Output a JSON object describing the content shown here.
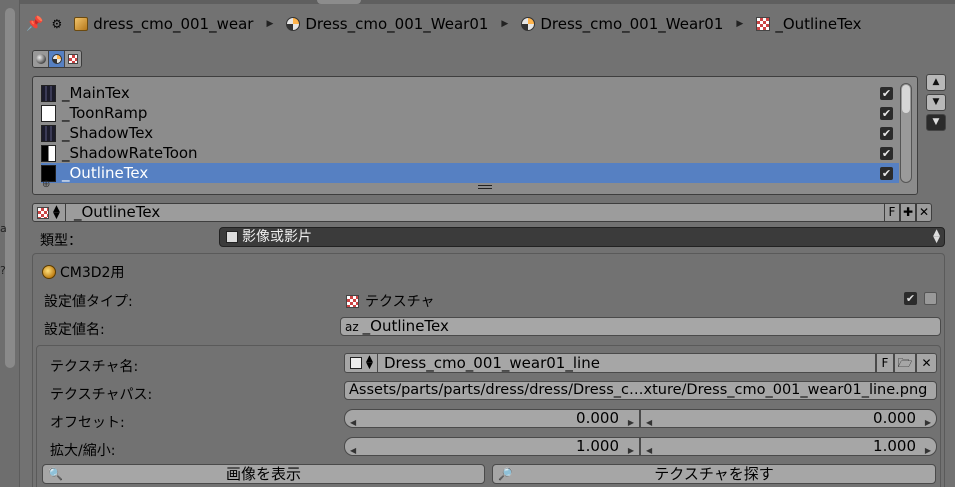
{
  "breadcrumb": {
    "items": [
      {
        "label": "dress_cmo_001_wear",
        "icon": "object-cube-icon"
      },
      {
        "label": "Dress_cmo_001_Wear01",
        "icon": "material-sphere-icon"
      },
      {
        "label": "Dress_cmo_001_Wear01",
        "icon": "material-sphere-icon"
      },
      {
        "label": "_OutlineTex",
        "icon": "texture-checker-icon"
      }
    ]
  },
  "context_tabs": [
    "world-sphere-icon",
    "material-sphere-icon",
    "texture-checker-icon"
  ],
  "texture_slots": {
    "items": [
      {
        "label": "_MainTex",
        "checked": true,
        "thumb": "dark"
      },
      {
        "label": "_ToonRamp",
        "checked": true,
        "thumb": "white"
      },
      {
        "label": "_ShadowTex",
        "checked": true,
        "thumb": "dark"
      },
      {
        "label": "_ShadowRateToon",
        "checked": true,
        "thumb": "half"
      },
      {
        "label": "_OutlineTex",
        "checked": true,
        "thumb": "black",
        "selected": true
      }
    ]
  },
  "datablock": {
    "name": "_OutlineTex",
    "fake_user": "F"
  },
  "type_row": {
    "label": "類型：",
    "value": "影像或影片"
  },
  "cm3d2": {
    "title": "CM3D2用",
    "setting_type_label": "設定値タイプ:",
    "setting_type_value": "テクスチャ",
    "setting_name_label": "設定値名:",
    "setting_name_value": "_OutlineTex",
    "texture_name_label": "テクスチャ名:",
    "texture_name_value": "Dress_cmo_001_wear01_line",
    "texture_name_fake": "F",
    "texture_path_label": "テクスチャパス:",
    "texture_path_value": "Assets/parts/parts/dress/dress/Dress_c…xture/Dress_cmo_001_wear01_line.png",
    "offset_label": "オフセット:",
    "offset_x": "0.000",
    "offset_y": "0.000",
    "scale_label": "拡大/縮小:",
    "scale_x": "1.000",
    "scale_y": "1.000",
    "show_image_button": "画像を表示",
    "find_texture_button": "テクスチャを探す"
  }
}
